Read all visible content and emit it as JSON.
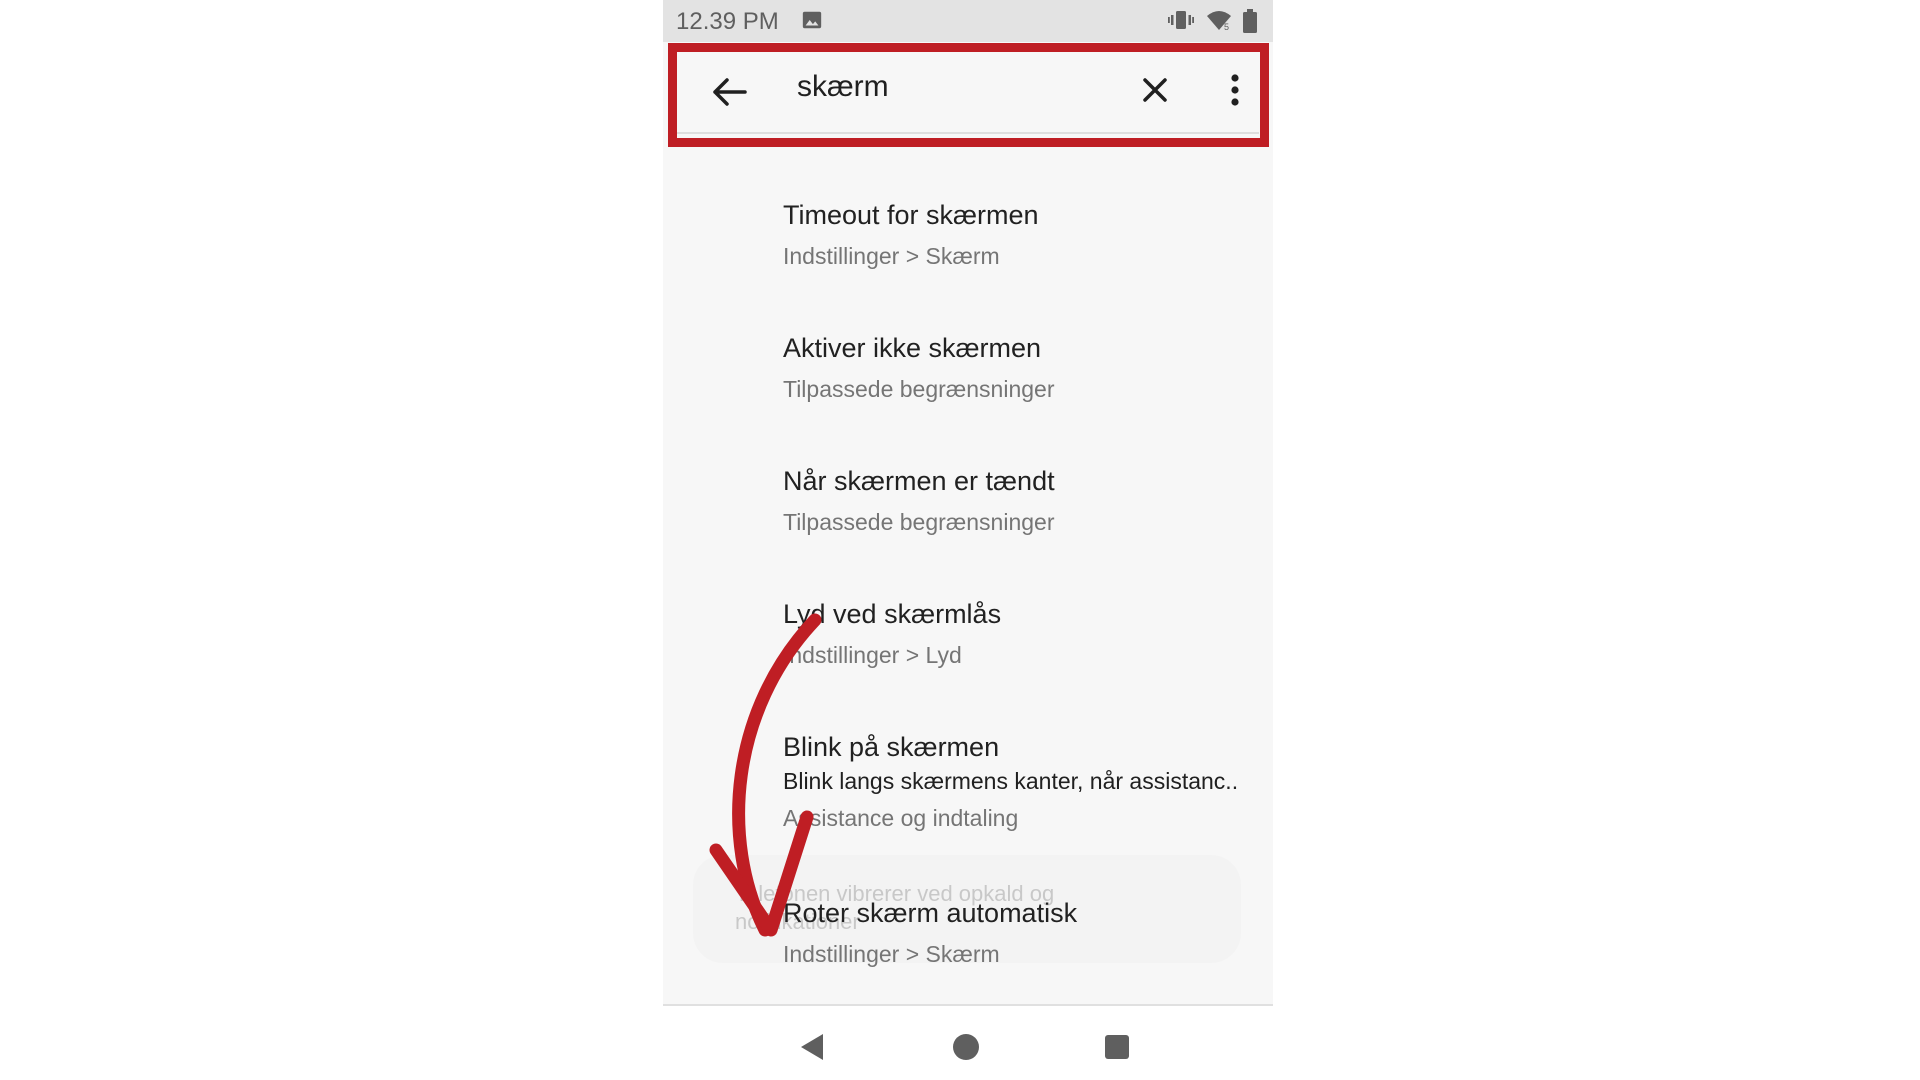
{
  "status_bar": {
    "time": "12.39 PM",
    "icons": [
      "image-icon",
      "vibrate-icon",
      "wifi-icon",
      "battery-icon"
    ]
  },
  "search": {
    "query": "skærm",
    "icons": {
      "back": "arrow-left-icon",
      "clear": "close-icon",
      "more": "more-vert-icon"
    },
    "highlight_color": "#bf1e24"
  },
  "results": [
    {
      "title": "Timeout for skærmen",
      "path": "Indstillinger > Skærm"
    },
    {
      "title": "Aktiver ikke skærmen",
      "path": "Tilpassede begrænsninger"
    },
    {
      "title": "Når skærmen er tændt",
      "path": "Tilpassede begrænsninger"
    },
    {
      "title": "Lyd ved skærmlås",
      "path": "Indstillinger > Lyd"
    },
    {
      "title": "Blink på skærmen",
      "summary": "Blink langs skærmens kanter, når assistanc..",
      "path": "Assistance og indtaling"
    },
    {
      "title": "Roter skærm automatisk",
      "path": "Indstillinger > Skærm"
    }
  ],
  "toast": {
    "text": "Telefonen vibrerer ved opkald og notifikationer"
  },
  "nav_bar": {
    "icons": [
      "nav-back-icon",
      "nav-home-icon",
      "nav-recents-icon"
    ]
  },
  "annotation": {
    "arrow_color": "#bf1e24"
  }
}
